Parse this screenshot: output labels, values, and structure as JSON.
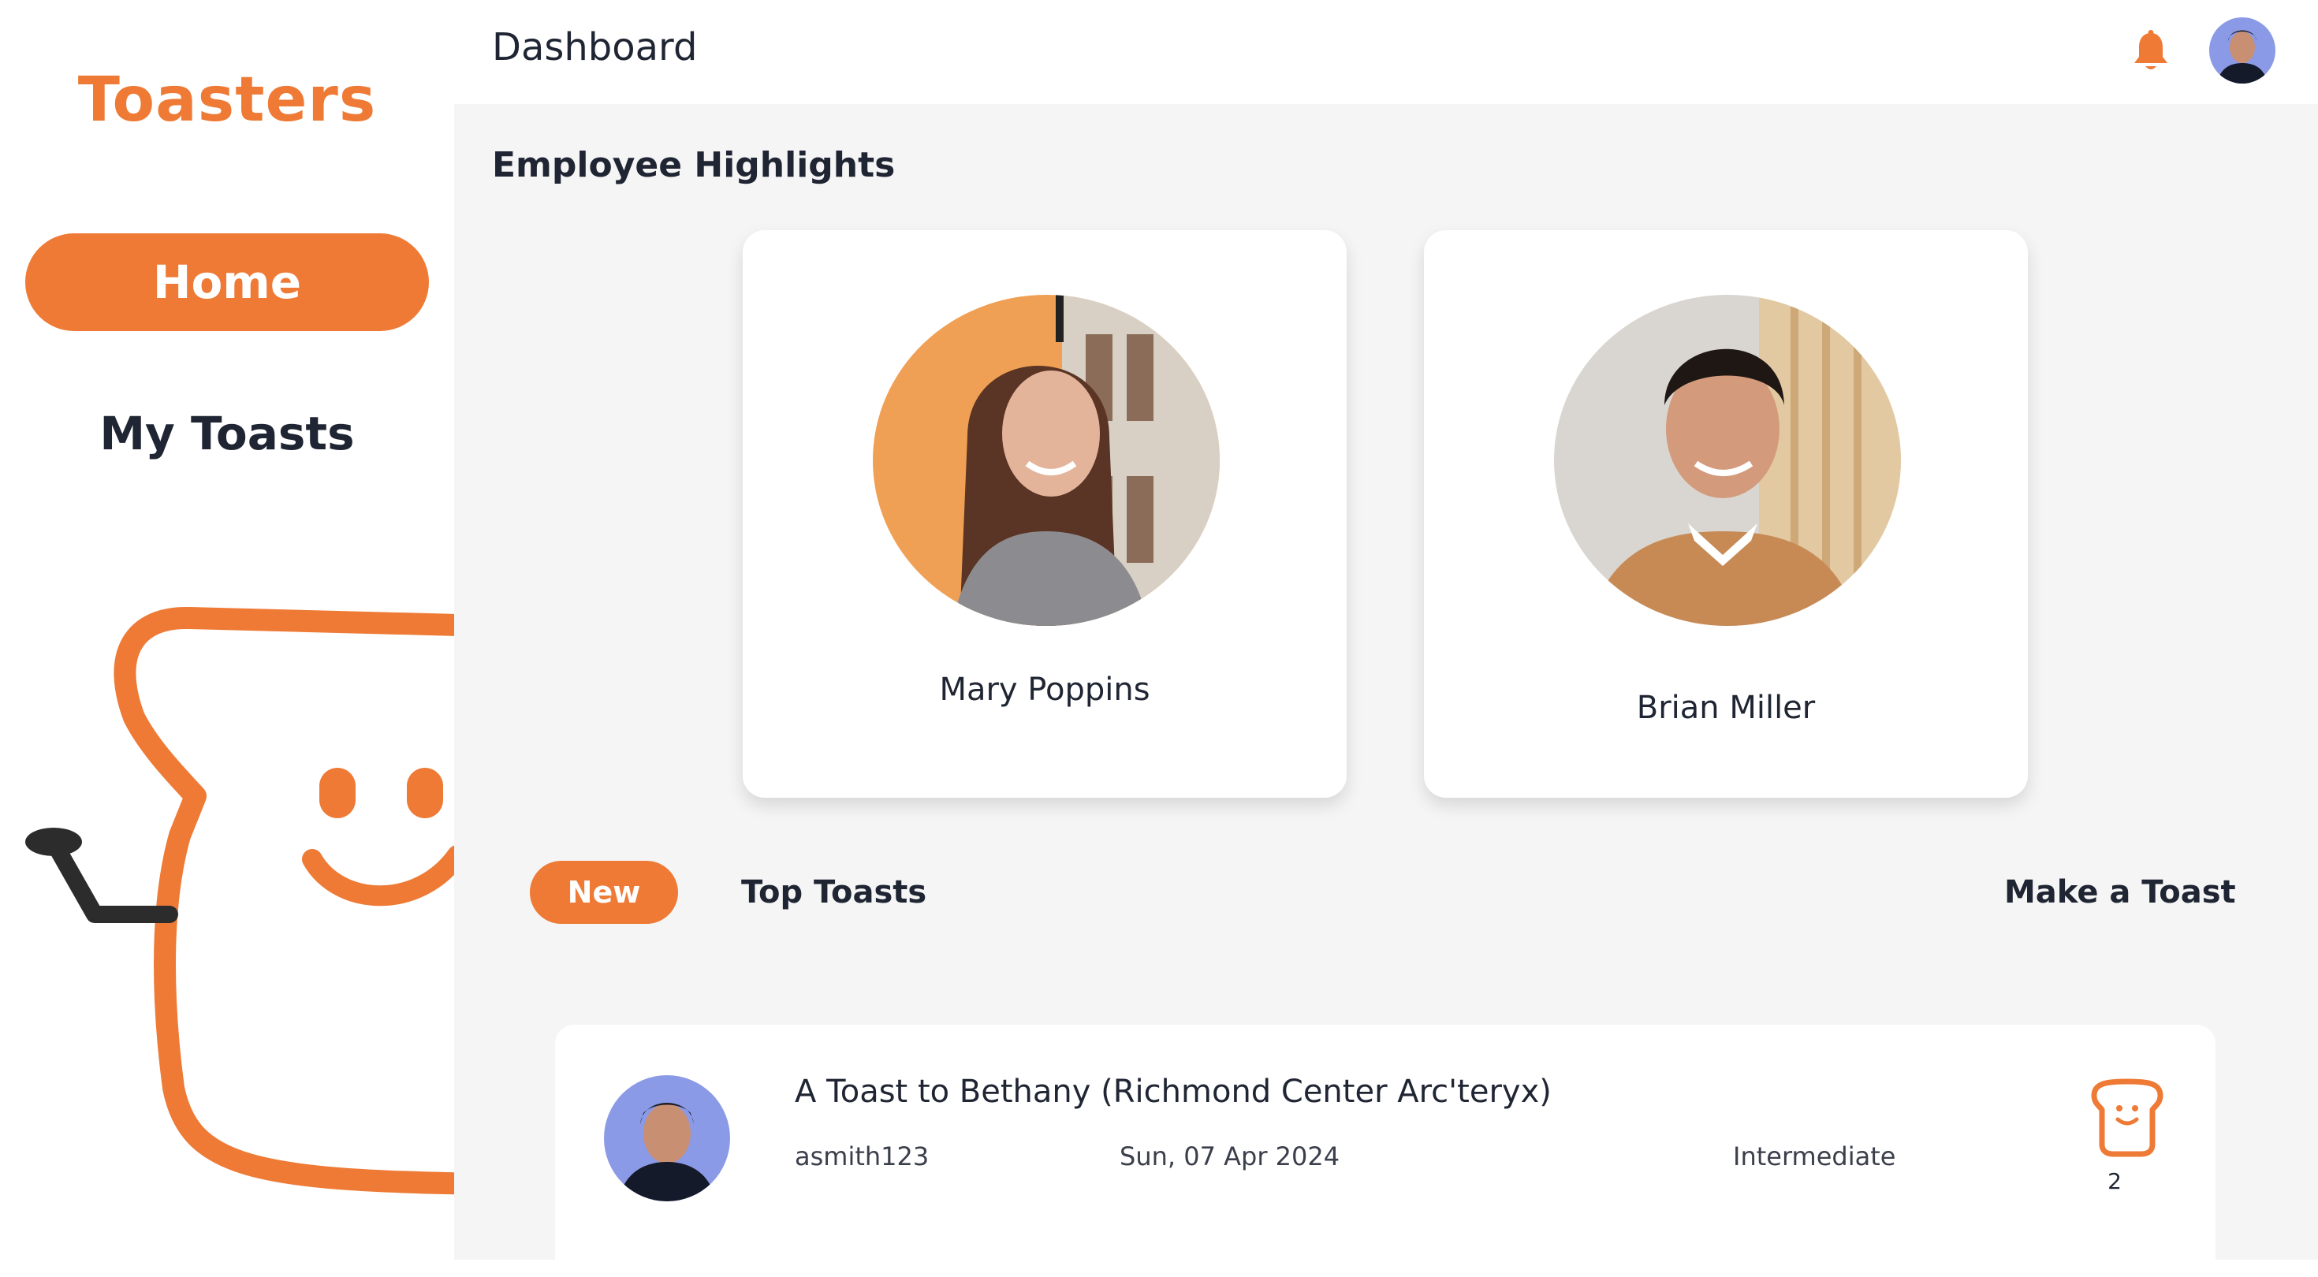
{
  "app": {
    "logo": "Toasters"
  },
  "sidebar": {
    "items": [
      {
        "label": "Home",
        "active": true
      },
      {
        "label": "My Toasts",
        "active": false
      }
    ]
  },
  "header": {
    "title": "Dashboard",
    "bell_icon": "bell-icon",
    "avatar": "user-avatar"
  },
  "highlights": {
    "title": "Employee Highlights",
    "employees": [
      {
        "name": "Mary Poppins"
      },
      {
        "name": "Brian Miller"
      }
    ]
  },
  "tabs": {
    "new": "New",
    "top": "Top Toasts",
    "make": "Make a Toast"
  },
  "toasts": [
    {
      "title": "A Toast to Bethany (Richmond Center Arc'teryx)",
      "author": "asmith123",
      "date": "Sun, 07 Apr 2024",
      "level": "Intermediate",
      "count": "2",
      "icon": "toast-icon"
    }
  ],
  "colors": {
    "accent": "#ee7a35",
    "text": "#1f2533",
    "background": "#f5f5f5"
  }
}
